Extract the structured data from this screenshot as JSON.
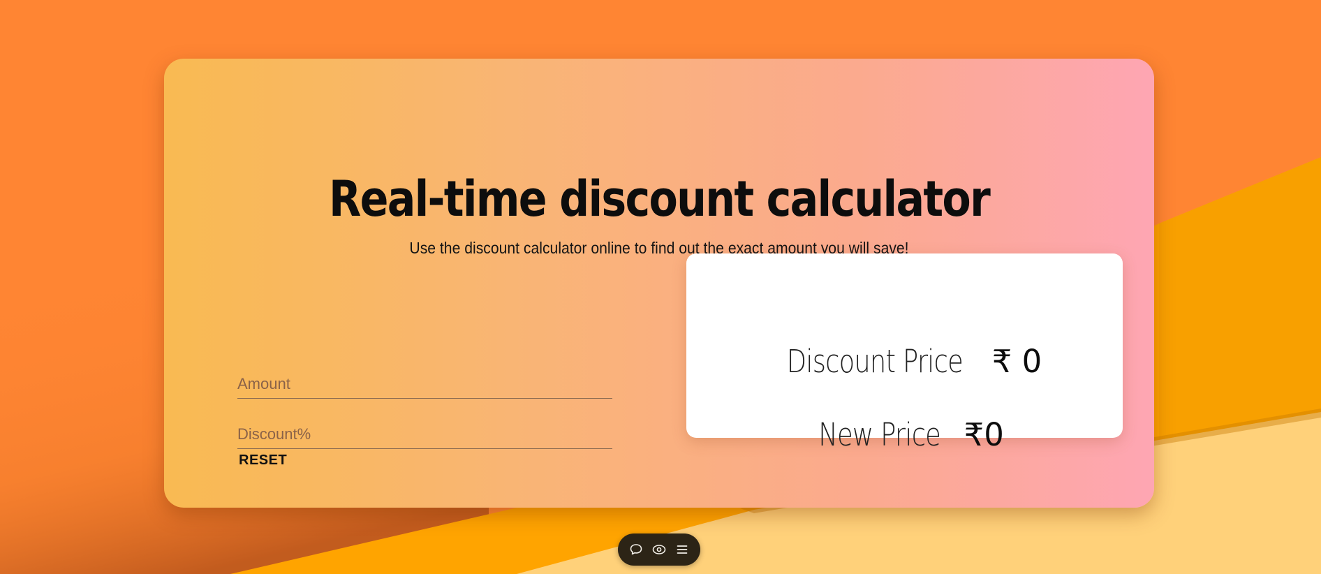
{
  "title": "Real-time discount calculator",
  "subtitle": "Use the discount calculator online to find out the exact amount you will save!",
  "form": {
    "amount_placeholder": "Amount",
    "discount_placeholder": "Discount%",
    "amount_value": "",
    "discount_value": "",
    "reset_label": "RESET"
  },
  "result": {
    "discount_price_label": "Discount Price",
    "discount_price_value": "₹ 0",
    "new_price_label": "New Price",
    "new_price_value": "₹0"
  },
  "toolbar": {
    "icons": [
      "chat-icon",
      "eye-icon",
      "menu-icon"
    ]
  },
  "colors": {
    "background": "#ff8533",
    "card_gradient_start": "#f9ba52",
    "card_gradient_end": "#fea6b3",
    "accent_stripe": "#ffa400",
    "light_stripe": "#ffd17a",
    "toolbar_bg": "#2c2416"
  }
}
